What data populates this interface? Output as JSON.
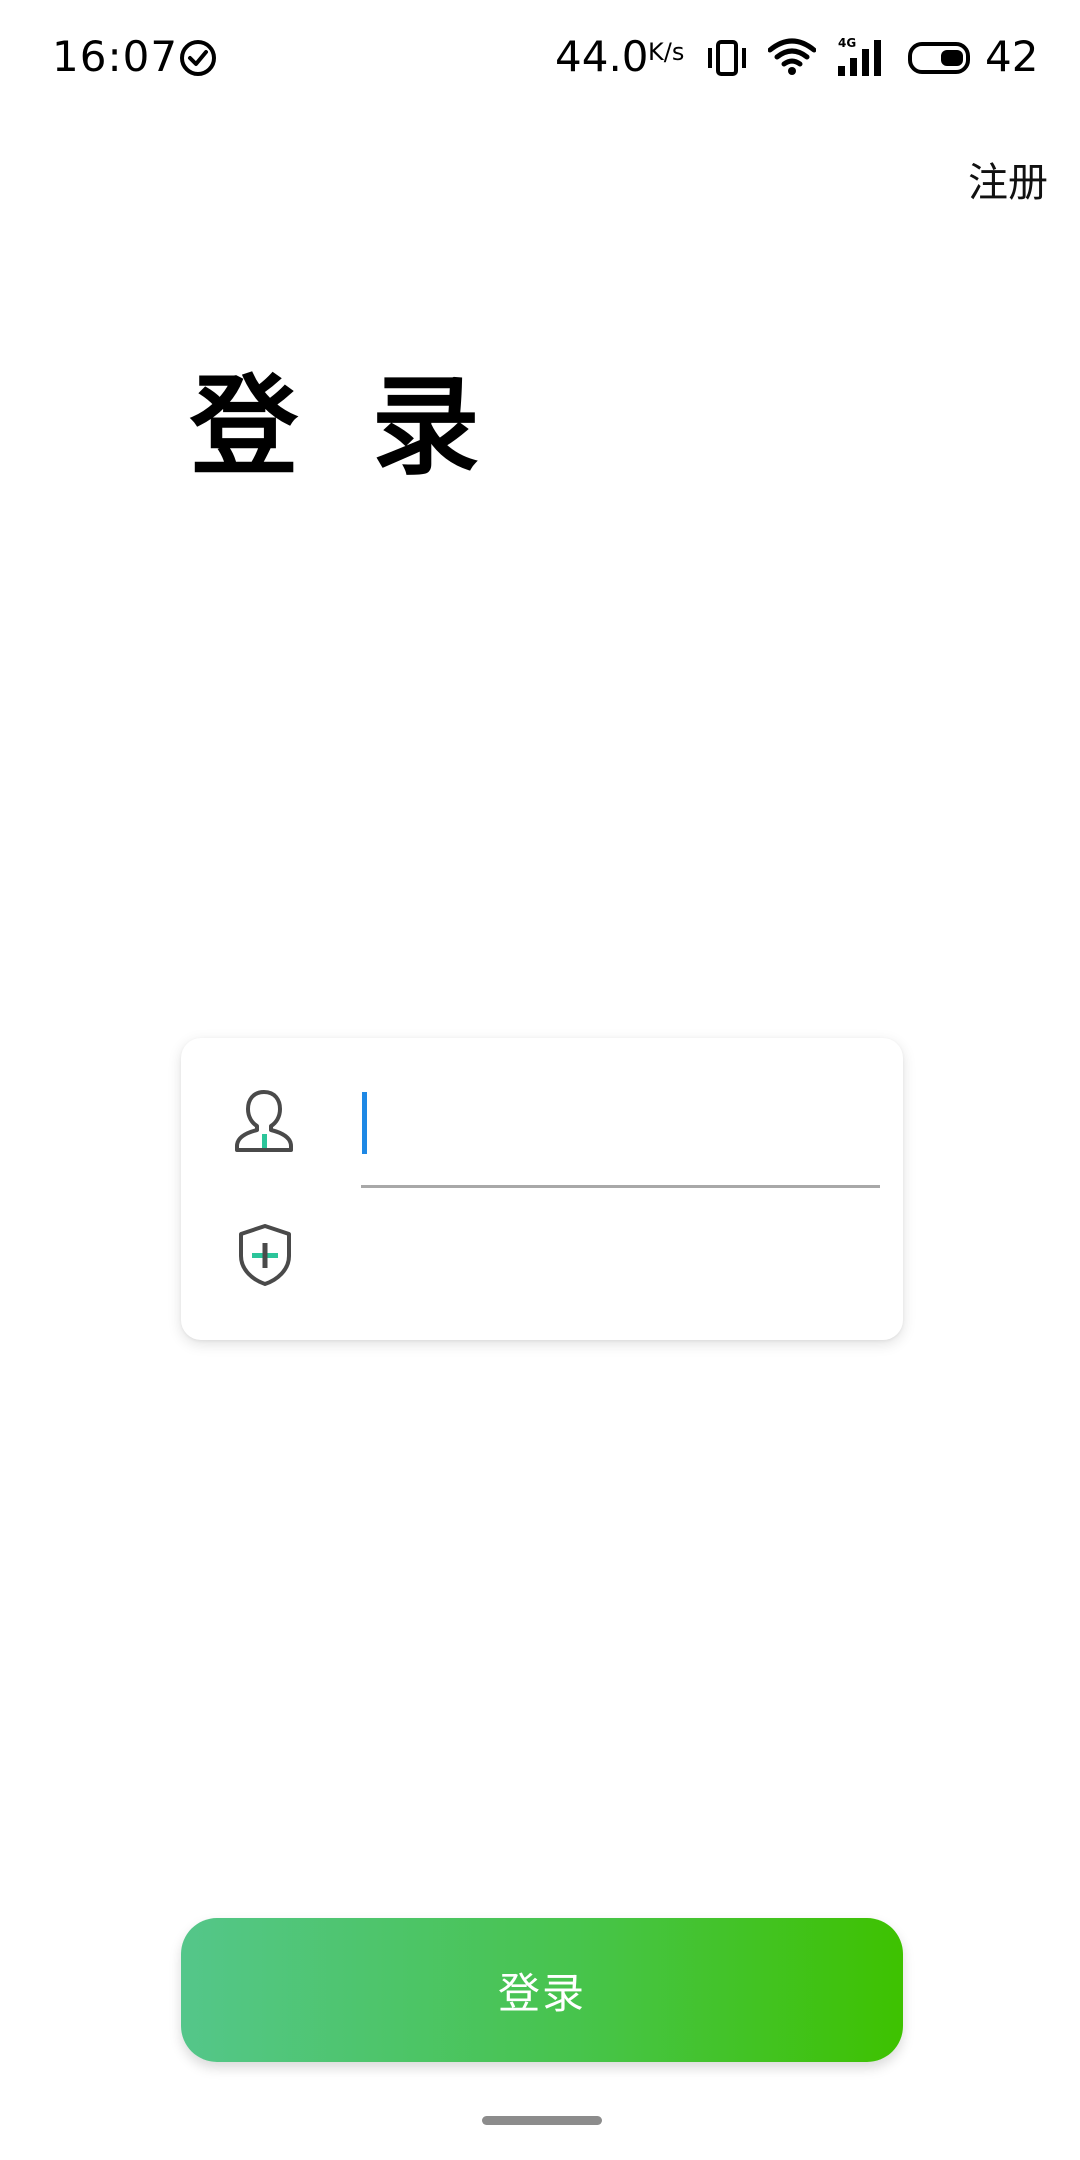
{
  "status_bar": {
    "time": "16:07",
    "net_speed": "44.0",
    "net_speed_unit": "K/s",
    "battery_level": "42",
    "icons": [
      "check-circle-icon",
      "vibrate-icon",
      "wifi-icon",
      "cellular-4g-icon",
      "battery-icon"
    ]
  },
  "header": {
    "register_label": "注册"
  },
  "page": {
    "title": "登 录"
  },
  "form": {
    "username_value": "",
    "username_placeholder": "",
    "password_value": "",
    "password_placeholder": "",
    "icons": [
      "user-icon",
      "shield-plus-icon"
    ],
    "accent_color": "#1e88e5",
    "icon_accent_color": "#2bc59a"
  },
  "login_button": {
    "label": "登录",
    "gradient_start": "#54c68a",
    "gradient_end": "#3ec200"
  }
}
